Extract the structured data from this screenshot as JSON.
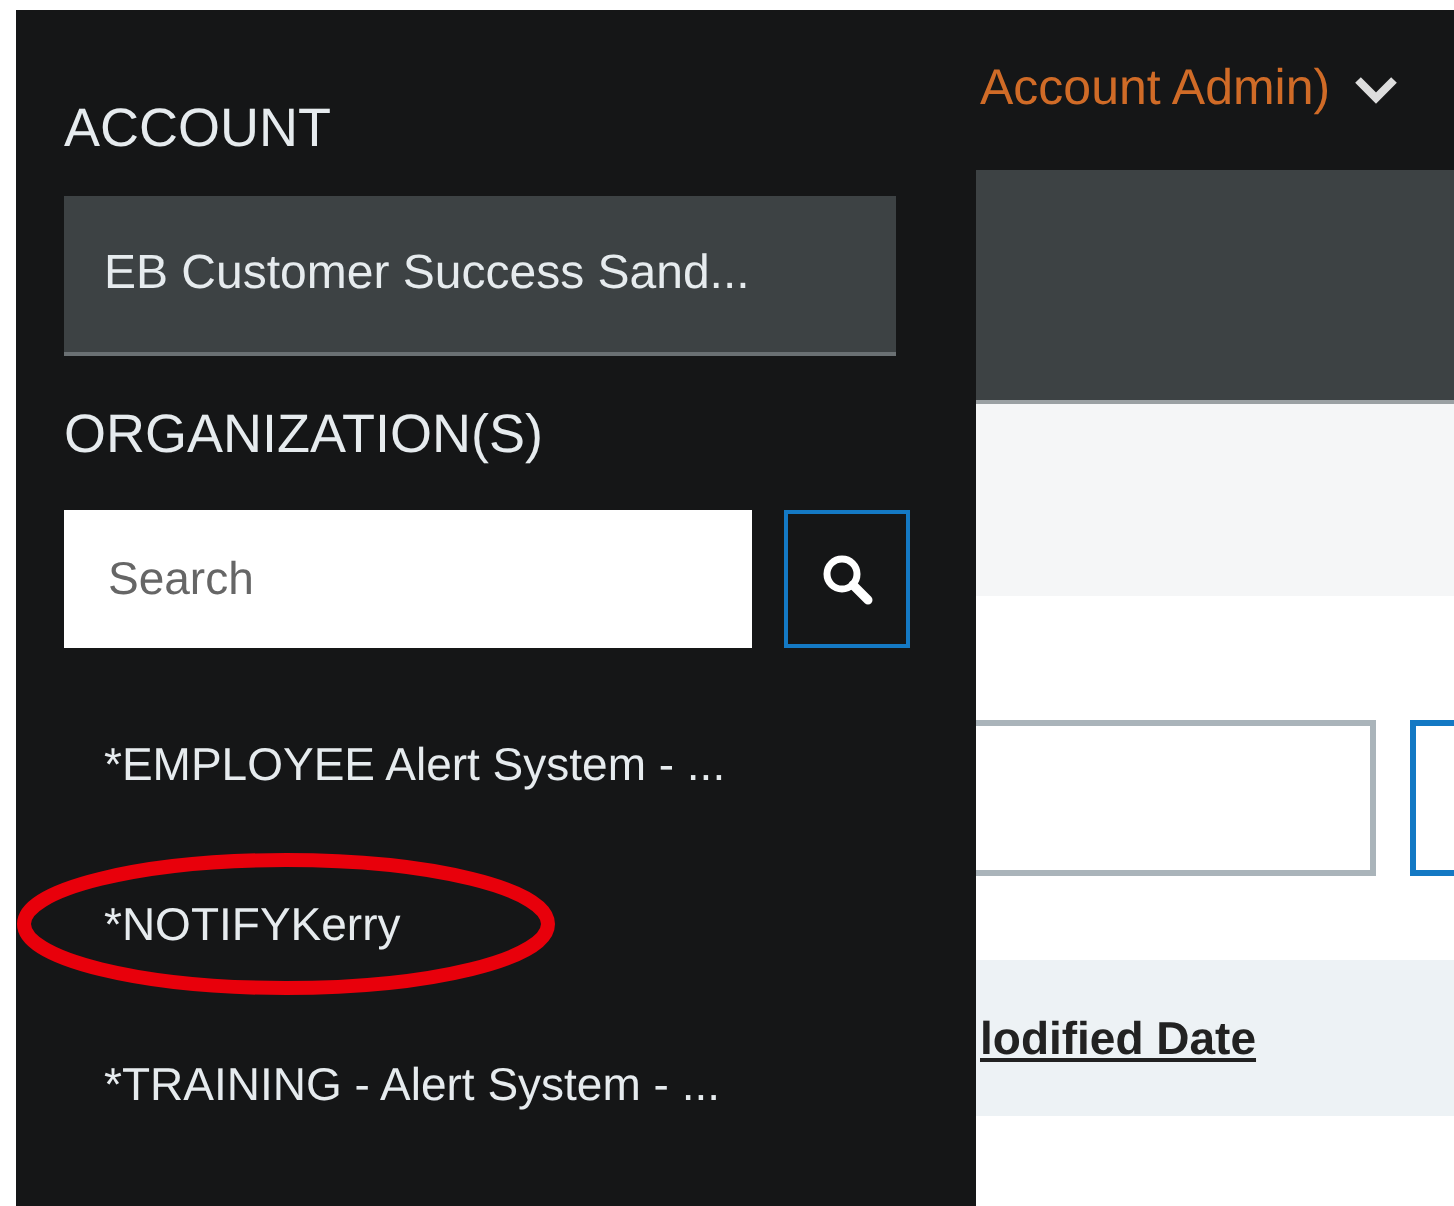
{
  "header": {
    "user_menu": "Account Admin)"
  },
  "sidebar": {
    "account_label": "ACCOUNT",
    "account": "EB Customer Success Sand...",
    "organizations_label": "ORGANIZATION(S)",
    "search": {
      "placeholder": "Search"
    },
    "organizations": [
      {
        "name": "*EMPLOYEE Alert System - ...",
        "highlighted": false
      },
      {
        "name": "*NOTIFYKerry",
        "highlighted": true
      },
      {
        "name": "*TRAINING - Alert System - ...",
        "highlighted": false
      }
    ]
  },
  "table": {
    "columns": [
      "lodified Date"
    ]
  }
}
